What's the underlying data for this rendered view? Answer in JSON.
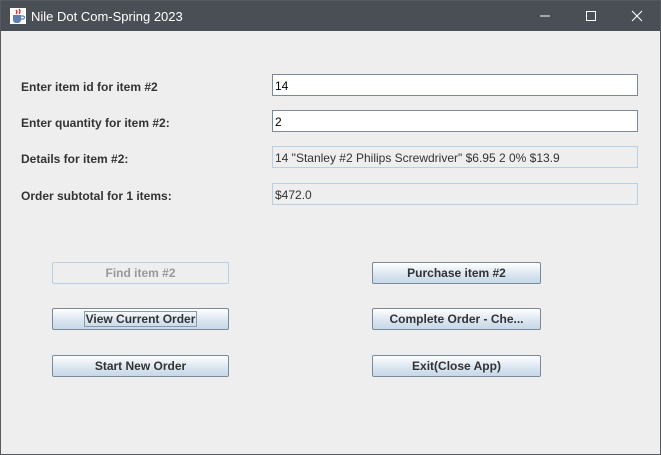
{
  "window": {
    "title": "Nile Dot Com-Spring 2023"
  },
  "form": {
    "item_id": {
      "label": "Enter item id for item #2",
      "value": "14"
    },
    "quantity": {
      "label": "Enter quantity for item #2:",
      "value": "2"
    },
    "details": {
      "label": "Details for item #2:",
      "value": "14 \"Stanley #2 Philips Screwdriver\" $6.95 2 0% $13.9"
    },
    "subtotal": {
      "label": "Order subtotal for 1 items:",
      "value": "$472.0"
    }
  },
  "buttons": {
    "find": {
      "label": "Find item #2",
      "enabled": false
    },
    "purchase": {
      "label": "Purchase item #2",
      "enabled": true
    },
    "view_order": {
      "label": "View Current Order",
      "enabled": true
    },
    "complete_order": {
      "label": "Complete Order - Che...",
      "enabled": true
    },
    "start_new": {
      "label": "Start New Order",
      "enabled": true
    },
    "exit": {
      "label": "Exit(Close App)",
      "enabled": true
    }
  },
  "icons": {
    "app": "java-cup-icon",
    "minimize": "minimize-icon",
    "maximize": "maximize-icon",
    "close": "close-icon"
  }
}
